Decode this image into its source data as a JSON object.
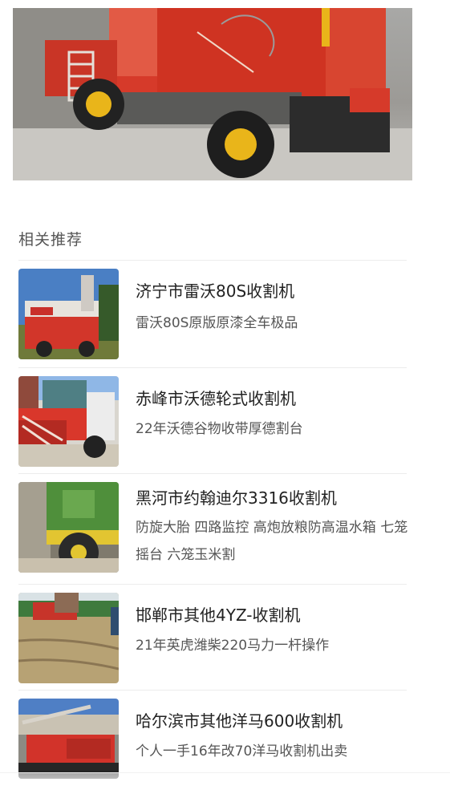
{
  "hero": {
    "image_icon": "combine-harvester-photo"
  },
  "section": {
    "title": "相关推荐"
  },
  "items": [
    {
      "title": "济宁市雷沃80S收割机",
      "desc": "雷沃80S原版原漆全车极品",
      "image_icon": "red-harvester-photo"
    },
    {
      "title": "赤峰市沃德轮式收割机",
      "desc": "22年沃德谷物收带厚德割台",
      "image_icon": "red-wheeled-harvester-photo"
    },
    {
      "title": "黑河市约翰迪尔3316收割机",
      "desc": "防旋大胎 四路监控 高炮放粮防高温水箱 七笼摇台 六笼玉米割",
      "image_icon": "green-harvester-photo"
    },
    {
      "title": "邯郸市其他4YZ-收割机",
      "desc": "21年英虎潍柴220马力一杆操作",
      "image_icon": "field-harvester-photo"
    },
    {
      "title": "哈尔滨市其他洋马600收割机",
      "desc": "个人一手16年改70洋马收割机出卖",
      "image_icon": "red-tracked-harvester-photo"
    }
  ],
  "colors": {
    "machine_red": "#d63a2a",
    "machine_yellow": "#e9b51a",
    "text_primary": "#222222",
    "text_secondary": "#555555",
    "divider": "#ececec"
  }
}
